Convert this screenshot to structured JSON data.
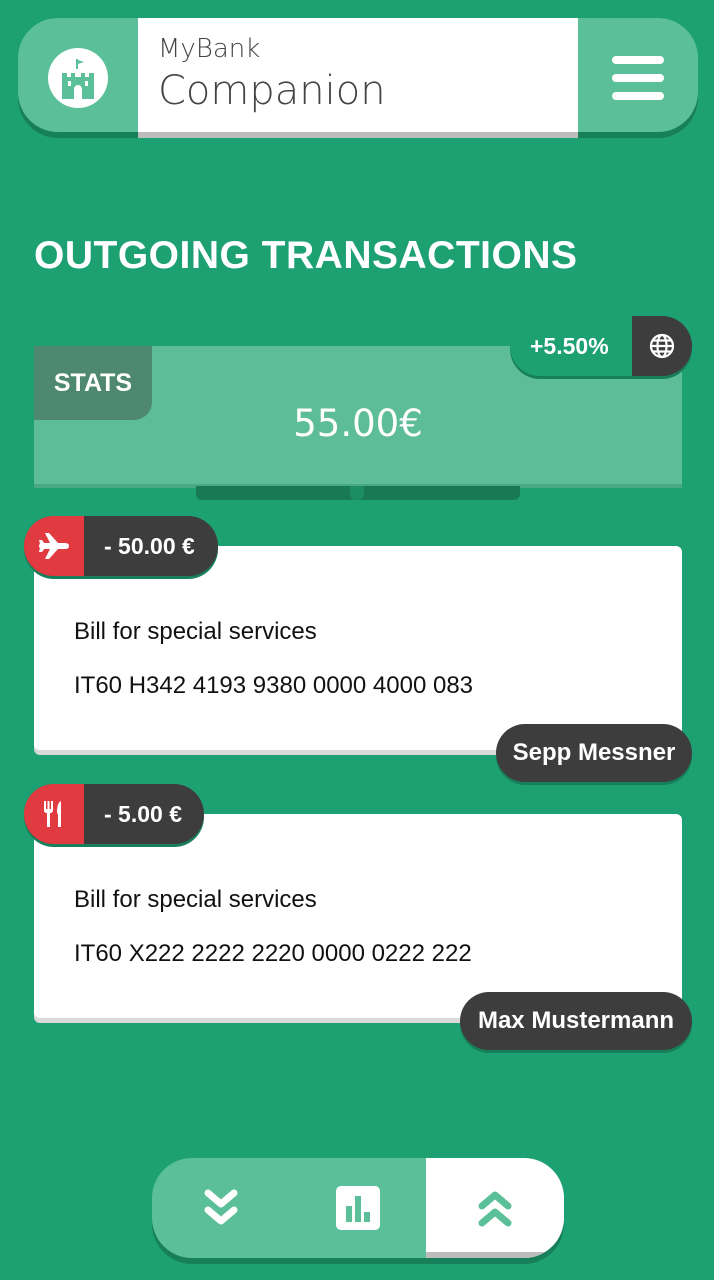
{
  "header": {
    "brand_small": "MyBank",
    "brand_big": "Companion",
    "logo_icon": "castle-icon",
    "menu_icon": "hamburger-menu-icon"
  },
  "page": {
    "title": "OUTGOING TRANSACTIONS"
  },
  "stats": {
    "tab_label": "STATS",
    "amount": "55.00€",
    "change": "+5.50%",
    "change_icon": "globe-icon"
  },
  "transactions": [
    {
      "amount": "- 50.00 €",
      "category_icon": "airplane-icon",
      "description": "Bill for special services",
      "iban": "IT60 H342 4193 9380 0000 4000 083",
      "recipient": "Sepp Messner"
    },
    {
      "amount": "- 5.00 €",
      "category_icon": "fork-knife-icon",
      "description": "Bill for special services",
      "iban": "IT60 X222 2222 2220 0000 0222 222",
      "recipient": "Max Mustermann"
    }
  ],
  "bottom_nav": {
    "items": [
      {
        "icon": "chevrons-down-icon",
        "active": false
      },
      {
        "icon": "bar-chart-icon",
        "active": false
      },
      {
        "icon": "chevrons-up-icon",
        "active": true
      }
    ]
  },
  "colors": {
    "background": "#1ea172",
    "accent_light": "#5bbf99",
    "dark": "#3d3d3d",
    "alert_red": "#e13b41"
  }
}
